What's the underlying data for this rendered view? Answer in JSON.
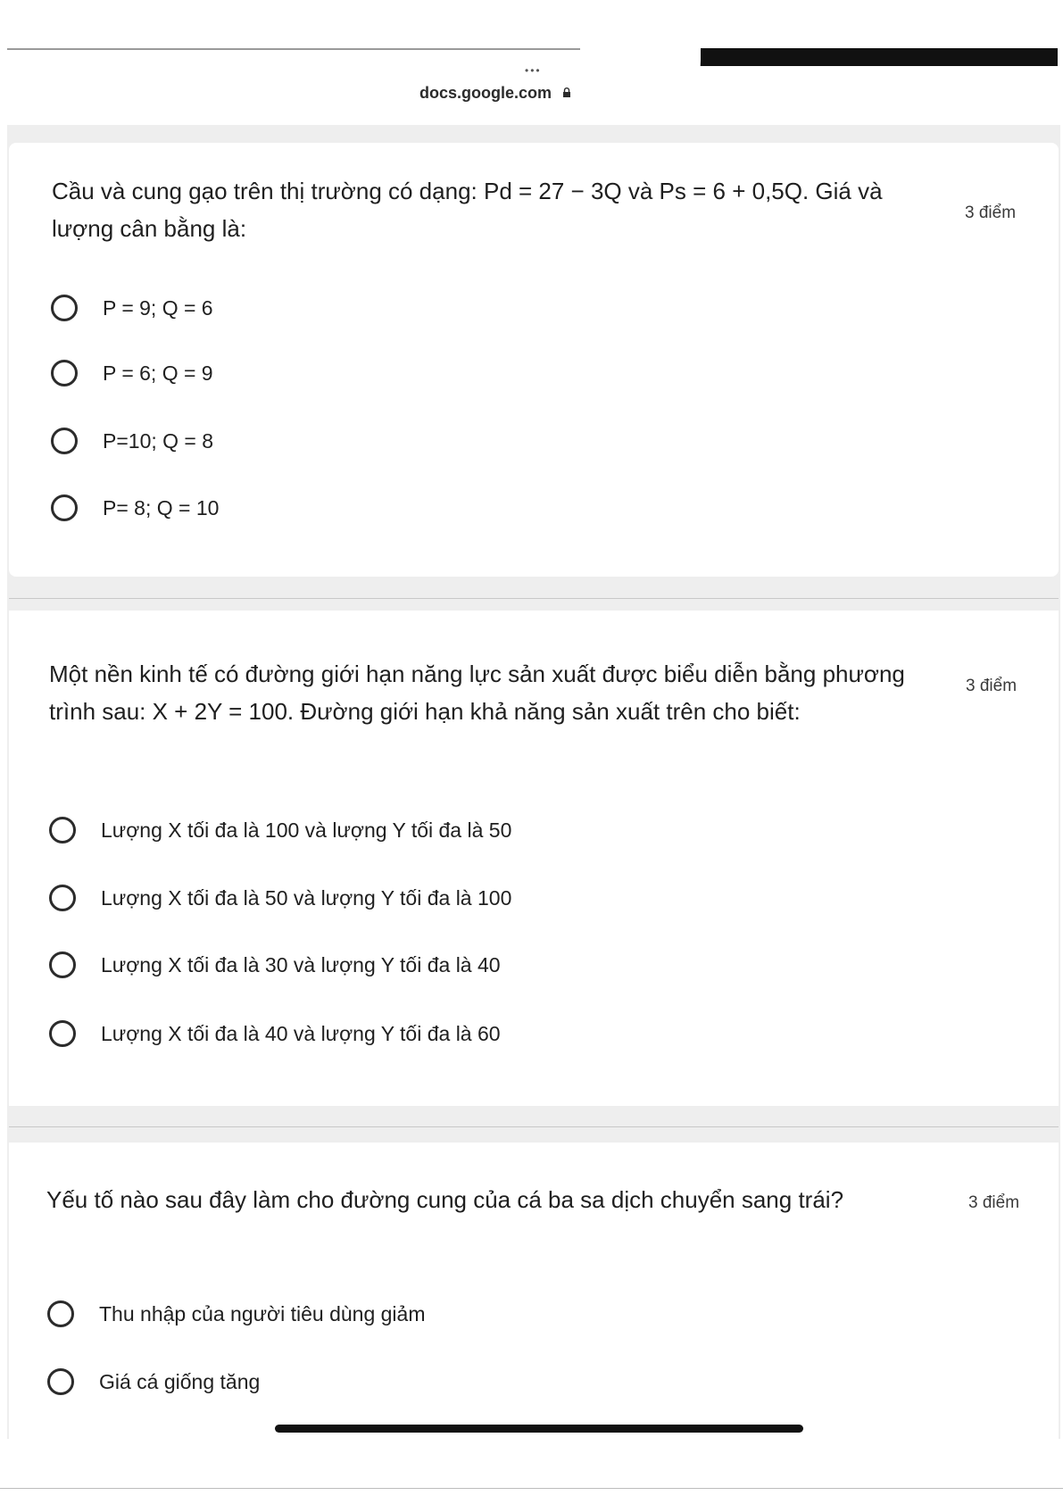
{
  "browser": {
    "dots": "•••",
    "url": "docs.google.com"
  },
  "questions": [
    {
      "title": "Cầu và cung gạo trên thị trường có dạng: Pd = 27 − 3Q và Ps = 6 + 0,5Q. Giá và lượng cân bằng là:",
      "points": "3 điểm",
      "options": [
        "P = 9; Q = 6",
        "P = 6; Q = 9",
        "P=10; Q = 8",
        "P= 8; Q = 10"
      ]
    },
    {
      "title": "Một nền kinh tế có đường giới hạn năng lực sản xuất được biểu diễn bằng phương trình sau: X + 2Y = 100. Đường giới hạn khả năng sản xuất trên cho biết:",
      "points": "3 điểm",
      "options": [
        "Lượng X tối đa là 100 và lượng Y tối đa là 50",
        "Lượng X tối đa là 50 và lượng Y tối đa là 100",
        "Lượng X tối đa là 30 và lượng Y tối đa là 40",
        "Lượng X tối đa là 40 và lượng Y tối đa là 60"
      ]
    },
    {
      "title": "Yếu tố nào sau đây làm cho đường cung của cá ba sa dịch chuyển sang trái?",
      "points": "3 điểm",
      "options": [
        "Thu nhập của người tiêu dùng giảm",
        "Giá cá giống tăng"
      ]
    }
  ]
}
